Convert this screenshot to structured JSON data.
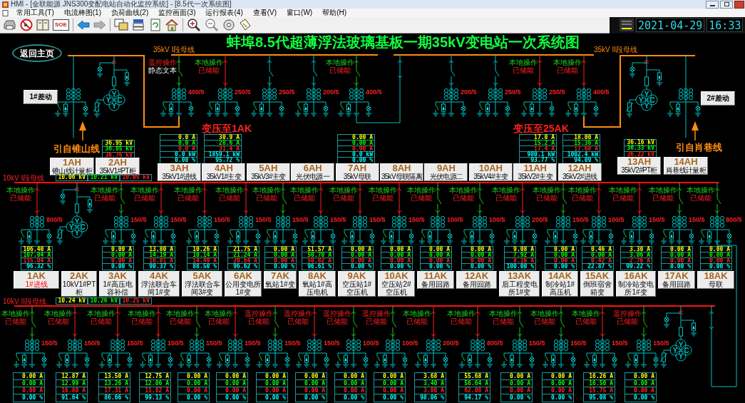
{
  "window": {
    "title": "HMI - [金联能源 JNS300变配电站自动化监控系统] - [8.5代一次系统图]"
  },
  "menu": [
    "常用工具(T)",
    "电流棒图(1)",
    "负荷曲线(2)",
    "监控画面(3)",
    "运行报表(4)",
    "查看(V)",
    "窗口(W)",
    "帮助(H)"
  ],
  "toolbar": {
    "soe_label": "SOE",
    "date": "2021-04-29",
    "time": "16:33"
  },
  "diagram": {
    "title": "蚌埠8.5代超薄浮法玻璃基板一期35kV变电站一次系统图",
    "home_button": "返回主页",
    "differential_buttons": [
      "1#差动",
      "2#差动"
    ],
    "section_35kv": {
      "bus_labels": [
        "35kV I段母线",
        "35kV II段母线"
      ],
      "sources": [
        "引自锥山线",
        "引自肖巷线"
      ],
      "transfer_labels": [
        "变压至1AK",
        "变压至25AK"
      ],
      "bays": [
        {
          "kind": "incoming",
          "code": "1AH",
          "name": "锥山线计量柜"
        },
        {
          "kind": "pt",
          "code": "2AH",
          "name": "35kV1#PT柜",
          "windings": [
            "Y",
            "Y",
            "C",
            "Y"
          ],
          "readings": [
            "36.95 kV",
            "36.85 kV",
            "36.76 kV"
          ]
        },
        {
          "kind": "feeder",
          "code": "3AH",
          "name": "35kV1#进线",
          "closed": false,
          "ct_ratio": "400/5",
          "operation": {
            "remote": true,
            "mode_text": "遥控操作",
            "charged": false,
            "status_text": "静态文本"
          },
          "readings": [
            "0.0 A",
            "0.0 A",
            "0.0 A",
            "0.0 kW",
            "0.00 %"
          ]
        },
        {
          "kind": "feeder",
          "code": "4AH",
          "name": "35kV1#主变",
          "closed": true,
          "ct_ratio": "250/5",
          "operation": {
            "remote": false,
            "mode_text": "本地操作",
            "charged": true,
            "status_text": "已储能"
          },
          "readings": [
            "30.9 A",
            "28.6 A",
            "31.4 A",
            "1859.1 kW",
            "95.72 %"
          ]
        },
        {
          "kind": "plain",
          "code": "5AH",
          "name": "35kV3#主变",
          "ct_ratio": "250/5"
        },
        {
          "kind": "plain",
          "code": "6AH",
          "name": "光伏电源一",
          "ct_ratio": "200/5"
        },
        {
          "kind": "feeder",
          "code": "7AH",
          "name": "35kV母联",
          "closed": false,
          "ct_ratio": "400/5",
          "operation": {
            "remote": false,
            "mode_text": "本地操作",
            "charged": true,
            "status_text": "已储能"
          },
          "readings": [
            "0.00 A",
            "0.00 A",
            "0.00 A",
            "0.0 kW",
            "0.00 %"
          ]
        },
        {
          "kind": "tie",
          "code": "8AH",
          "name": "35kV母联隔离"
        },
        {
          "kind": "plain",
          "code": "9AH",
          "name": "光伏电源二",
          "ct_ratio": "200/5"
        },
        {
          "kind": "plain",
          "code": "10AH",
          "name": "35kV4#主变",
          "ct_ratio": "250/5"
        },
        {
          "kind": "feeder",
          "code": "11AH",
          "name": "35kV2#主变",
          "closed": true,
          "ct_ratio": "250/5",
          "operation": {
            "remote": false,
            "mode_text": "本地操作",
            "charged": true,
            "status_text": "已储能"
          },
          "readings": [
            "17.0 A",
            "15.2 A",
            "17.4 A",
            "980.1 kW",
            "93.77 %"
          ]
        },
        {
          "kind": "feeder",
          "code": "12AH",
          "name": "35kV2#进线",
          "closed": true,
          "ct_ratio": "400/5",
          "operation": {
            "remote": false,
            "mode_text": "本地操作",
            "charged": true,
            "status_text": "已储能"
          },
          "readings": [
            "18.00 A",
            "15.36 A",
            "17.68 A",
            "1002.4 kW",
            "94.09 %"
          ]
        },
        {
          "kind": "pt",
          "code": "13AH",
          "name": "35kV2#PT柜",
          "windings": [
            "Y",
            "Y",
            "C",
            "Y"
          ],
          "readings": [
            "36.16 kV",
            "36.33 kV",
            "36.22 kV"
          ]
        },
        {
          "kind": "incoming",
          "code": "14AH",
          "name": "肖巷线计量柜"
        }
      ]
    },
    "section_10kv_1": {
      "bus_label": "10kV I段母线",
      "bus_voltages": [
        "10.06 kV",
        "10.21 kV",
        "10.05 kV"
      ],
      "bays": [
        {
          "kind": "feeder",
          "code": "1AK",
          "name": "1#进线",
          "name_alert": true,
          "closed": true,
          "ct_ratio": "800/5",
          "operation": {
            "remote": false,
            "mode_text": "本地操作",
            "charged": true,
            "status_text": "已储能"
          },
          "readings": [
            "106.40 A",
            "107.04 A",
            "115.04 A",
            "96.32 %"
          ]
        },
        {
          "kind": "pt",
          "code": "2AK",
          "name": "10kV1#PT柜",
          "name_alert": false,
          "windings": [
            "Y",
            "Y",
            "C",
            "Y"
          ]
        },
        {
          "kind": "feeder",
          "code": "3AK",
          "name": "1#高压电容补偿",
          "name_alert": false,
          "closed": false,
          "ct_ratio": "150/5",
          "operation": {
            "remote": false,
            "mode_text": "本地操作",
            "charged": true,
            "status_text": "已储能"
          },
          "readings": [
            "0.00 A",
            "0.00 A",
            "0.00 A",
            "0.00 %"
          ]
        },
        {
          "kind": "feeder",
          "code": "4AK",
          "name": "浮法联合车间1#变",
          "name_alert": false,
          "closed": true,
          "ct_ratio": "150/5",
          "operation": {
            "remote": false,
            "mode_text": "本地操作",
            "charged": true,
            "status_text": "已储能"
          },
          "readings": [
            "13.80 A",
            "14.19 A",
            "18.81 A",
            "90.37 %"
          ]
        },
        {
          "kind": "feeder",
          "code": "5AK",
          "name": "浮法联合车间3#变",
          "name_alert": false,
          "closed": true,
          "ct_ratio": "150/5",
          "operation": {
            "remote": false,
            "mode_text": "本地操作",
            "charged": true,
            "status_text": "已储能"
          },
          "readings": [
            "10.26 A",
            "10.14 A",
            "14.49 A",
            "88.50 %"
          ]
        },
        {
          "kind": "feeder",
          "code": "6AK",
          "name": "公用变电所1#变",
          "name_alert": false,
          "closed": true,
          "ct_ratio": "150/5",
          "operation": {
            "remote": false,
            "mode_text": "本地操作",
            "charged": true,
            "status_text": "已储能"
          },
          "readings": [
            "21.75 A",
            "21.24 A",
            "20.64 A",
            "96.62 %"
          ]
        },
        {
          "kind": "feeder",
          "code": "7AK",
          "name": "氧站1#变",
          "name_alert": false,
          "closed": false,
          "ct_ratio": "150/5",
          "operation": {
            "remote": false,
            "mode_text": "本地操作",
            "charged": true,
            "status_text": "已储能"
          },
          "readings": [
            "0.00 A",
            "0.00 A",
            "0.00 A",
            "0.00 %"
          ]
        },
        {
          "kind": "feeder",
          "code": "8AK",
          "name": "氧站1#高压电机",
          "name_alert": false,
          "closed": true,
          "ct_ratio": "150/5",
          "operation": {
            "remote": false,
            "mode_text": "本地操作",
            "charged": true,
            "status_text": "已储能"
          },
          "readings": [
            "51.57 A",
            "50.70 A",
            "50.82 A",
            "96.61 %"
          ]
        },
        {
          "kind": "feeder",
          "code": "9AK",
          "name": "空压站1#空压机",
          "name_alert": false,
          "closed": true,
          "ct_ratio": "150/5",
          "operation": {
            "remote": false,
            "mode_text": "本地操作",
            "charged": true,
            "status_text": "已储能"
          },
          "readings": [
            "0.00 A",
            "0.00 A",
            "0.00 A",
            "0.00 %"
          ]
        },
        {
          "kind": "feeder",
          "code": "10AK",
          "name": "空压站2#空压机",
          "name_alert": false,
          "closed": true,
          "ct_ratio": "150/5",
          "operation": {
            "remote": false,
            "mode_text": "本地操作",
            "charged": true,
            "status_text": "已储能"
          },
          "readings": [
            "0.00 A",
            "0.00 A",
            "0.00 A",
            "0.00 %"
          ]
        },
        {
          "kind": "feeder",
          "code": "11AK",
          "name": "备用回路",
          "name_alert": false,
          "closed": false,
          "ct_ratio": "100/5",
          "operation": {
            "remote": false,
            "mode_text": "本地操作",
            "charged": true,
            "status_text": "已储能"
          },
          "readings": [
            "0.00 A",
            "0.00 A",
            "0.00 A",
            "0.00 %"
          ]
        },
        {
          "kind": "feeder",
          "code": "12AK",
          "name": "备用回路",
          "name_alert": false,
          "closed": false,
          "ct_ratio": "100/5",
          "operation": {
            "remote": false,
            "mode_text": "本地操作",
            "charged": true,
            "status_text": "已储能"
          },
          "readings": [
            "0.00 A",
            "0.00 A",
            "0.00 A",
            "0.00 %"
          ]
        },
        {
          "kind": "feeder",
          "code": "13AK",
          "name": "后工程变电所1#变",
          "name_alert": false,
          "closed": true,
          "ct_ratio": "200/5",
          "operation": {
            "remote": false,
            "mode_text": "本地操作",
            "charged": true,
            "status_text": "已储能"
          },
          "readings": [
            "9.08 A",
            "7.92 A",
            "8.16 A",
            "100.00 %"
          ]
        },
        {
          "kind": "feeder",
          "code": "14AK",
          "name": "制冷站1#高压机",
          "name_alert": false,
          "closed": false,
          "ct_ratio": "150/5",
          "operation": {
            "remote": false,
            "mode_text": "本地操作",
            "charged": true,
            "status_text": "已储能"
          },
          "readings": [
            "0.00 A",
            "0.00 A",
            "0.00 A",
            "0.00 %"
          ]
        },
        {
          "kind": "feeder",
          "code": "15AK",
          "name": "倒班宿舍箱变",
          "name_alert": false,
          "closed": true,
          "ct_ratio": "100/5",
          "operation": {
            "remote": false,
            "mode_text": "本地操作",
            "charged": true,
            "status_text": "已储能"
          },
          "readings": [
            "0.46 A",
            "0.00 A",
            "0.42 A",
            "22.87 %"
          ]
        },
        {
          "kind": "feeder",
          "code": "16AK",
          "name": "制冷站变电所1#变",
          "name_alert": false,
          "closed": true,
          "ct_ratio": "150/5",
          "operation": {
            "remote": false,
            "mode_text": "本地操作",
            "charged": true,
            "status_text": "已储能"
          },
          "readings": [
            "3.30 A",
            "3.06 A",
            "2.76 A",
            "99.22 %"
          ]
        },
        {
          "kind": "feeder",
          "code": "17AK",
          "name": "备用回路",
          "name_alert": false,
          "closed": false,
          "ct_ratio": "150/5",
          "operation": {
            "remote": false,
            "mode_text": "本地操作",
            "charged": true,
            "status_text": "已储能"
          },
          "readings": [
            "0.00 A",
            "0.00 A",
            "0.00 A",
            "0.00 %"
          ]
        },
        {
          "kind": "feeder",
          "code": "18AK",
          "name": "母联",
          "name_alert": false,
          "closed": false,
          "ct_ratio": "800/5",
          "operation": {
            "remote": false,
            "mode_text": "本地操作",
            "charged": true,
            "status_text": "已储能"
          },
          "readings": [
            "0.00 A",
            "0.00 A",
            "0.00 A",
            "0.00 %"
          ]
        }
      ]
    },
    "section_10kv_2": {
      "bus_label": "10kV II段母线",
      "bus_voltages": [
        "10.24 kV",
        "10.26 kV",
        "10.25 kV"
      ],
      "bays": [
        {
          "kind": "feeder",
          "closed": false,
          "ct_ratio": "150/5",
          "operation": {
            "remote": false,
            "mode_text": "本地操作",
            "charged": true,
            "status_text": "已储能"
          },
          "readings": [
            "0.00 A",
            "0.00 A",
            "0.00 A",
            "0.00 %"
          ]
        },
        {
          "kind": "feeder",
          "closed": true,
          "ct_ratio": "150/5",
          "operation": {
            "remote": false,
            "mode_text": "本地操作",
            "charged": true,
            "status_text": "已储能"
          },
          "readings": [
            "12.87 A",
            "12.99 A",
            "16.80 A",
            "91.64 %"
          ]
        },
        {
          "kind": "feeder",
          "closed": true,
          "ct_ratio": "150/5",
          "operation": {
            "remote": false,
            "mode_text": "本地操作",
            "charged": true,
            "status_text": "已储能"
          },
          "readings": [
            "13.50 A",
            "13.26 A",
            "17.31 A",
            "86.66 %"
          ]
        },
        {
          "kind": "feeder",
          "closed": true,
          "ct_ratio": "150/5",
          "operation": {
            "remote": false,
            "mode_text": "本地操作",
            "charged": true,
            "status_text": "已储能"
          },
          "readings": [
            "12.75 A",
            "12.06 A",
            "11.82 A",
            "99.13 %"
          ]
        },
        {
          "kind": "feeder",
          "closed": false,
          "ct_ratio": "150/5",
          "operation": {
            "remote": false,
            "mode_text": "本地操作",
            "charged": true,
            "status_text": "已储能"
          },
          "readings": [
            "0.00 A",
            "0.00 A",
            "0.00 A",
            "0.00 %"
          ]
        },
        {
          "kind": "feeder",
          "closed": true,
          "ct_ratio": "150/5",
          "operation": {
            "remote": false,
            "mode_text": "本地操作",
            "charged": true,
            "status_text": "已储能"
          },
          "readings": [
            "0.00 A",
            "0.00 A",
            "0.00 A",
            "0.00 %"
          ]
        },
        {
          "kind": "feeder",
          "closed": false,
          "ct_ratio": "150/5",
          "operation": {
            "remote": true,
            "mode_text": "遥控操作",
            "charged": true,
            "status_text": "已储能"
          },
          "readings": [
            "0.00 A",
            "0.00 A",
            "0.00 A",
            "0.00 %"
          ]
        },
        {
          "kind": "feeder",
          "closed": true,
          "ct_ratio": "150/5",
          "operation": {
            "remote": true,
            "mode_text": "遥控操作",
            "charged": true,
            "status_text": "已储能"
          },
          "readings": [
            "0.00 A",
            "0.00 A",
            "0.00 A",
            "0.00 %"
          ]
        },
        {
          "kind": "feeder",
          "closed": false,
          "ct_ratio": "100/5",
          "operation": {
            "remote": true,
            "mode_text": "遥控操作",
            "charged": true,
            "status_text": "已储能"
          },
          "readings": [
            "0.00 A",
            "0.00 A",
            "0.00 A",
            "0.00 %"
          ]
        },
        {
          "kind": "feeder",
          "closed": false,
          "ct_ratio": "100/5",
          "operation": {
            "remote": true,
            "mode_text": "遥控操作",
            "charged": true,
            "status_text": "已储能"
          },
          "readings": [
            "0.00 A",
            "0.00 A",
            "0.00 A",
            "0.00 %"
          ]
        },
        {
          "kind": "feeder",
          "closed": true,
          "ct_ratio": "200/5",
          "operation": {
            "remote": false,
            "mode_text": "本地操作",
            "charged": true,
            "status_text": "已储能"
          },
          "readings": [
            "3.68 A",
            "3.40 A",
            "3.00 A",
            "98.06 %"
          ]
        },
        {
          "kind": "feeder",
          "closed": true,
          "ct_ratio": "800/5",
          "operation": {
            "remote": false,
            "mode_text": "本地操作",
            "charged": true,
            "status_text": "已储能"
          },
          "readings": [
            "55.68 A",
            "56.64 A",
            "62.08 A",
            "94.17 %"
          ]
        },
        {
          "kind": "feeder",
          "closed": false,
          "ct_ratio": "150/5",
          "operation": {
            "remote": false,
            "mode_text": "本地操作",
            "charged": true,
            "status_text": "已储能"
          },
          "readings": [
            "0.00 A",
            "0.00 A",
            "0.00 A",
            "0.00 %"
          ]
        },
        {
          "kind": "feeder",
          "closed": false,
          "ct_ratio": "150/5",
          "operation": {
            "remote": false,
            "mode_text": "本地操作",
            "charged": true,
            "status_text": "已储能"
          },
          "readings": [
            "0.00 A",
            "0.00 A",
            "0.00 A",
            "0.00 %"
          ]
        },
        {
          "kind": "feeder",
          "closed": true,
          "ct_ratio": "150/5",
          "operation": {
            "remote": false,
            "mode_text": "本地操作",
            "charged": true,
            "status_text": "已储能"
          },
          "readings": [
            "16.26 A",
            "16.50 A",
            "15.75 A",
            "95.08 %"
          ]
        },
        {
          "kind": "feeder",
          "closed": false,
          "ct_ratio": "150/5",
          "operation": {
            "remote": true,
            "mode_text": "遥控操作",
            "charged": true,
            "status_text": "已储能"
          },
          "readings": [
            "0.00 A",
            "0.00 A",
            "0.00 A",
            "0.00 %"
          ]
        },
        {
          "kind": "pt",
          "windings": [
            "Y",
            "Y",
            "C",
            "Y"
          ]
        },
        {
          "kind": "tie"
        }
      ]
    }
  }
}
